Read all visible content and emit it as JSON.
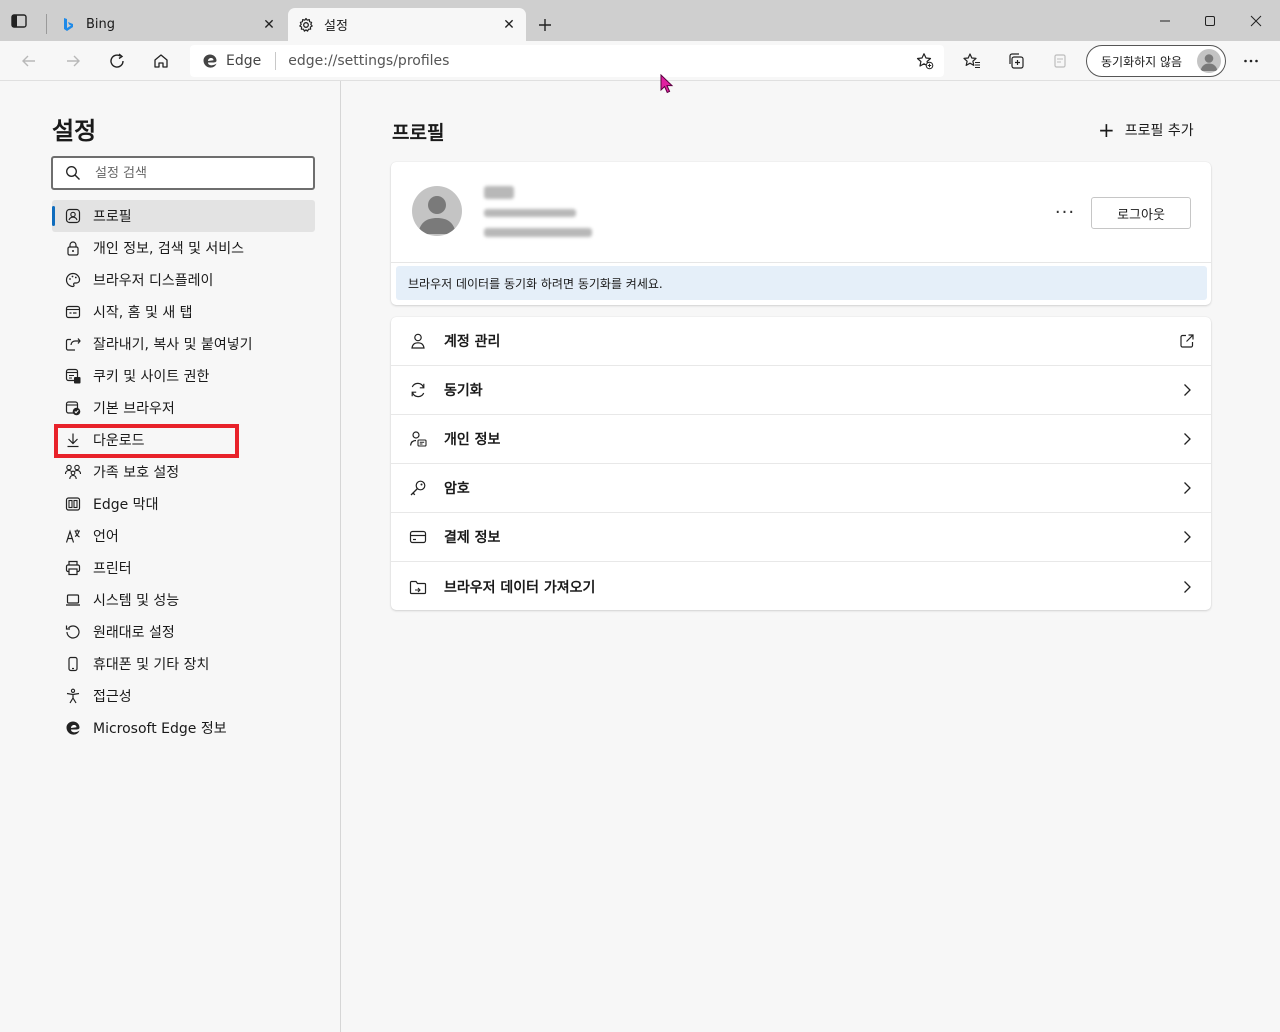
{
  "tabs": [
    {
      "title": "Bing",
      "active": false
    },
    {
      "title": "설정",
      "active": true
    }
  ],
  "address_bar": {
    "edge_label": "Edge",
    "url": "edge://settings/profiles"
  },
  "toolbar": {
    "sync_button_label": "동기화하지 않음"
  },
  "sidebar": {
    "title": "설정",
    "search_placeholder": "설정 검색",
    "items": [
      {
        "label": "프로필",
        "icon": "profile-icon"
      },
      {
        "label": "개인 정보, 검색 및 서비스",
        "icon": "lock-icon"
      },
      {
        "label": "브라우저 디스플레이",
        "icon": "palette-icon"
      },
      {
        "label": "시작, 홈 및 새 탭",
        "icon": "home-window-icon"
      },
      {
        "label": "잘라내기, 복사 및 붙여넣기",
        "icon": "share-icon"
      },
      {
        "label": "쿠키 및 사이트 권한",
        "icon": "cookie-icon"
      },
      {
        "label": "기본 브라우저",
        "icon": "default-browser-icon"
      },
      {
        "label": "다운로드",
        "icon": "download-icon"
      },
      {
        "label": "가족 보호 설정",
        "icon": "family-icon"
      },
      {
        "label": "Edge 막대",
        "icon": "edge-bar-icon"
      },
      {
        "label": "언어",
        "icon": "language-icon"
      },
      {
        "label": "프린터",
        "icon": "printer-icon"
      },
      {
        "label": "시스템 및 성능",
        "icon": "laptop-icon"
      },
      {
        "label": "원래대로 설정",
        "icon": "reset-icon"
      },
      {
        "label": "휴대폰 및 기타 장치",
        "icon": "phone-icon"
      },
      {
        "label": "접근성",
        "icon": "accessibility-icon"
      },
      {
        "label": "Microsoft Edge 정보",
        "icon": "edge-logo-icon"
      }
    ]
  },
  "main": {
    "title": "프로필",
    "add_profile_label": "프로필 추가",
    "profile_card": {
      "logout_label": "로그아웃",
      "more_label": "···",
      "sync_info": "브라우저 데이터를 동기화 하려면 동기화를 켜세요."
    },
    "rows": [
      {
        "label": "계정 관리",
        "icon": "person-icon",
        "trail": "external-link-icon"
      },
      {
        "label": "동기화",
        "icon": "sync-icon",
        "trail": "chevron-right-icon"
      },
      {
        "label": "개인 정보",
        "icon": "personal-info-icon",
        "trail": "chevron-right-icon"
      },
      {
        "label": "암호",
        "icon": "key-icon",
        "trail": "chevron-right-icon"
      },
      {
        "label": "결제 정보",
        "icon": "credit-card-icon",
        "trail": "chevron-right-icon"
      },
      {
        "label": "브라우저 데이터 가져오기",
        "icon": "import-folder-icon",
        "trail": "chevron-right-icon"
      }
    ]
  },
  "colors": {
    "accent": "#0f6cbd",
    "highlight": "#e8222a",
    "info_bg": "#e5eff9"
  }
}
